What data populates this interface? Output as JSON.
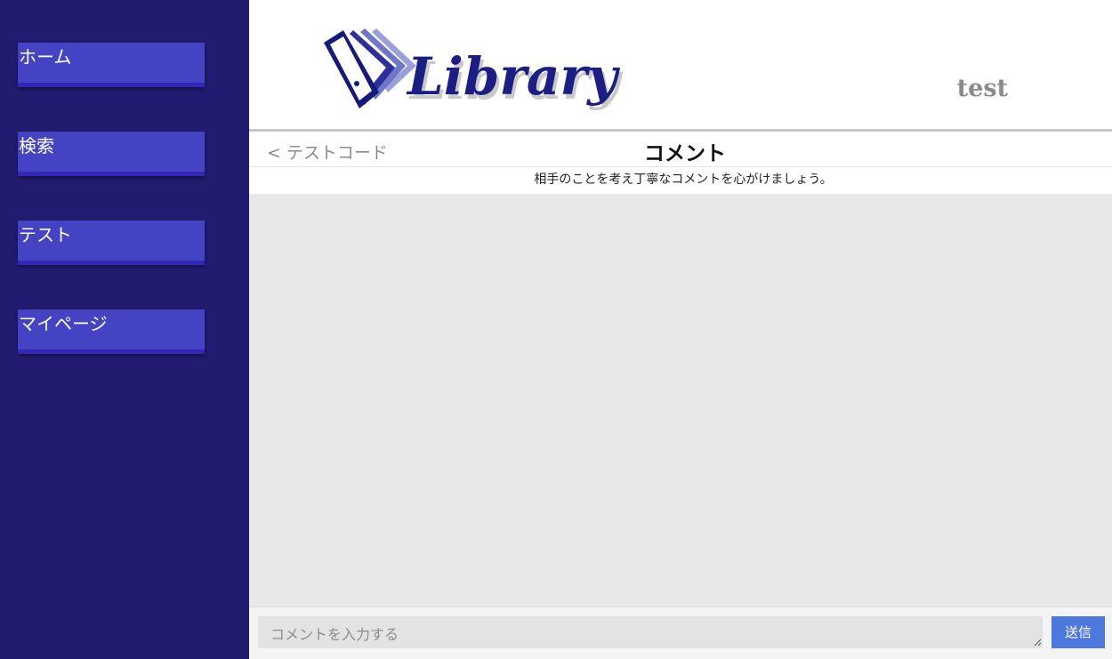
{
  "sidebar": {
    "items": [
      {
        "label": "ホーム"
      },
      {
        "label": "検索"
      },
      {
        "label": "テスト"
      },
      {
        "label": "マイページ"
      }
    ]
  },
  "header": {
    "logo_text": "Library",
    "username": "test"
  },
  "subbar": {
    "back_chevron": "<",
    "back_label": "テストコード",
    "title": "コメント"
  },
  "guideline": "相手のことを考え丁寧なコメントを心がけましょう。",
  "footer": {
    "input_placeholder": "コメントを入力する",
    "input_value": "",
    "send_label": "送信"
  },
  "colors": {
    "sidebar_bg": "#221c71",
    "nav_item_bg": "#4343c4",
    "send_button": "#4d79df",
    "comment_area_bg": "#e8e8e8"
  },
  "icons": {
    "logo": "book-pages-icon",
    "back": "chevron-left-icon",
    "resize": "resize-handle-icon"
  }
}
